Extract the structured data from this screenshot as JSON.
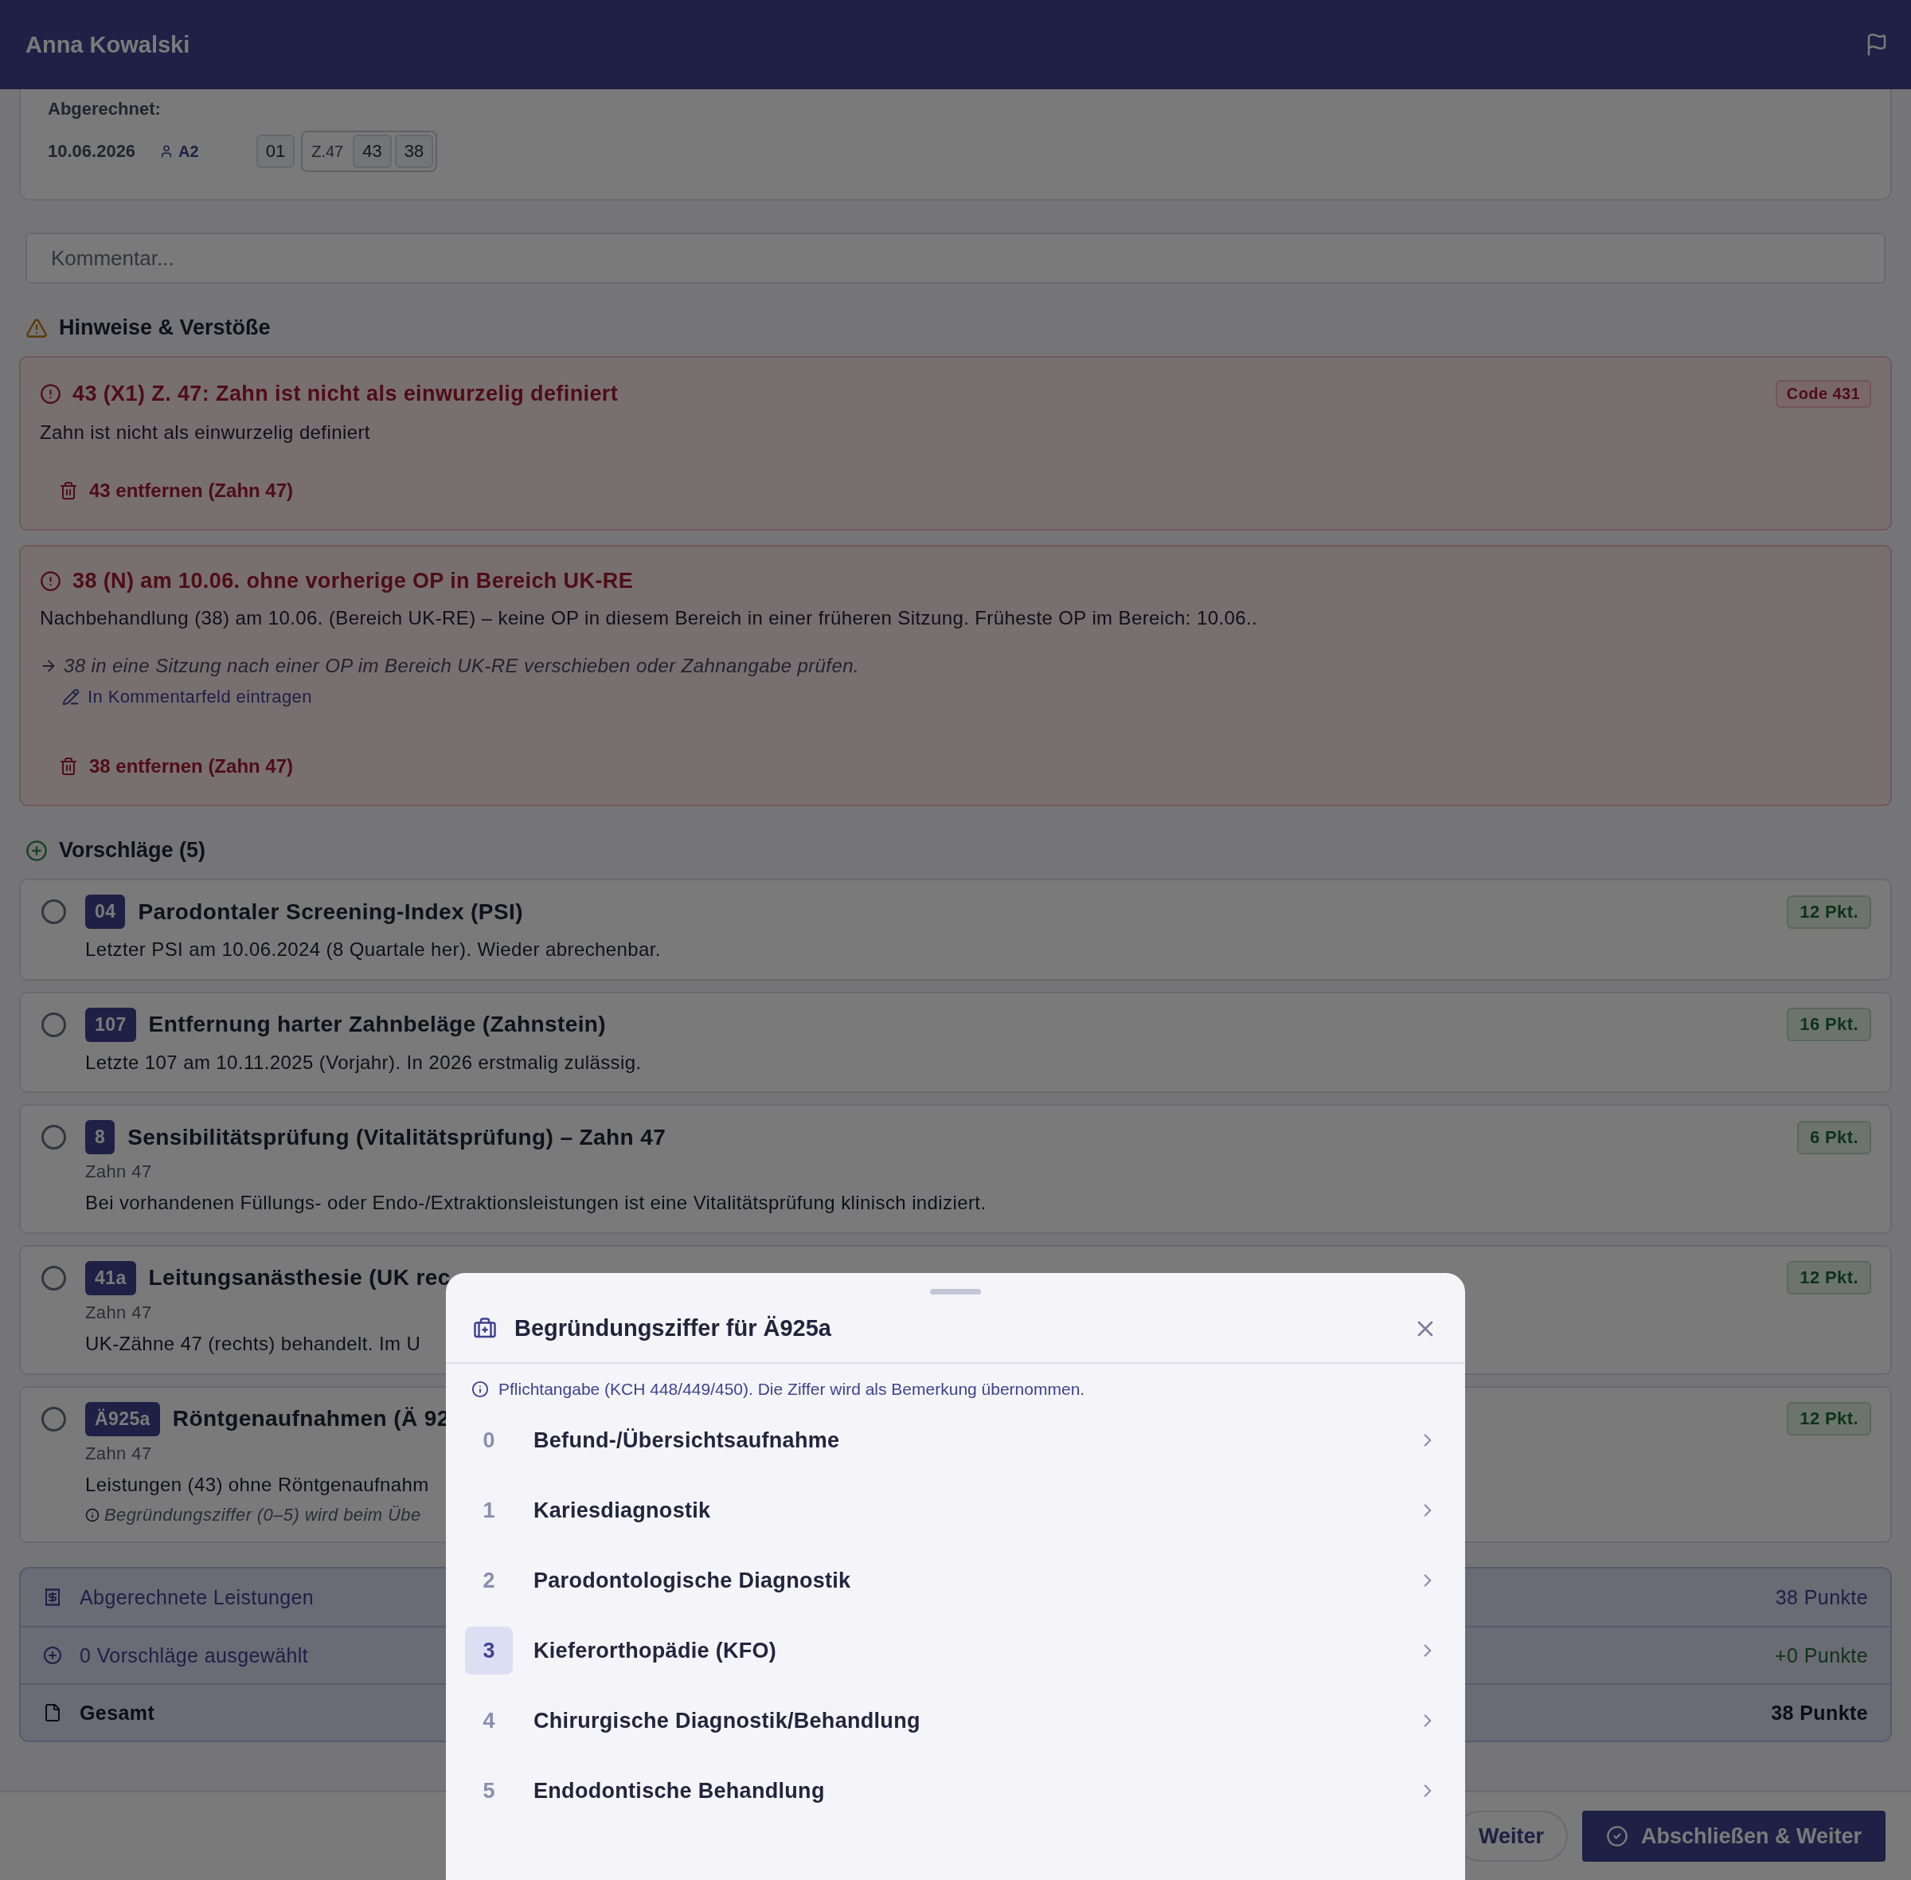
{
  "header": {
    "name": "Anna Kowalski"
  },
  "billed": {
    "label": "Abgerechnet:",
    "date": "10.06.2026",
    "user": "A2",
    "chips": [
      "01"
    ],
    "tooth_group": {
      "tooth": "Z.47",
      "codes": [
        "43",
        "38"
      ]
    }
  },
  "comment": {
    "placeholder": "Kommentar..."
  },
  "notices": {
    "title": "Hinweise & Verstöße",
    "items": [
      {
        "title": "43 (X1) Z. 47: Zahn ist nicht als einwurzelig definiert",
        "code": "Code 431",
        "text": "Zahn ist nicht als einwurzelig definiert",
        "action": "43 entfernen (Zahn 47)"
      },
      {
        "title": "38 (N) am 10.06. ohne vorherige OP in Bereich UK-RE",
        "text": "Nachbehandlung (38) am 10.06. (Bereich UK-RE) – keine OP in diesem Bereich in einer früheren Sitzung. Früheste OP im Bereich: 10.06..",
        "hint": "38 in eine Sitzung nach einer OP im Bereich UK-RE verschieben oder Zahnangabe prüfen.",
        "link": "In Kommentarfeld eintragen",
        "action": "38 entfernen (Zahn 47)"
      }
    ]
  },
  "suggestions": {
    "title": "Vorschläge (5)",
    "items": [
      {
        "code": "04",
        "title": "Parodontaler Screening-Index (PSI)",
        "text": "Letzter PSI am 10.06.2024 (8 Quartale her). Wieder abrechenbar.",
        "points": "12 Pkt.",
        "selected": false
      },
      {
        "code": "107",
        "title": "Entfernung harter Zahnbeläge (Zahnstein)",
        "text": "Letzte 107 am 10.11.2025 (Vorjahr). In 2026 erstmalig zulässig.",
        "points": "16 Pkt.",
        "selected": false
      },
      {
        "code": "8",
        "title": "Sensibilitätsprüfung (Vitalitätsprüfung) – Zahn 47",
        "tooth": "Zahn 47",
        "text": "Bei vorhandenen Füllungs- oder Endo-/Extraktionsleistungen ist eine Vitalitätsprüfung klinisch indiziert.",
        "points": "6 Pkt.",
        "selected": false
      },
      {
        "code": "41a",
        "title": "Leitungsanästhesie (UK rec",
        "tooth": "Zahn 47",
        "text": "UK-Zähne 47 (rechts) behandelt. Im U",
        "points": "12 Pkt.",
        "selected": false
      },
      {
        "code": "Ä925a",
        "title": "Röntgenaufnahmen (Ä 92",
        "tooth": "Zahn 47",
        "text": "Leistungen (43) ohne Röntgenaufnahm",
        "note": "Begründungsziffer (0–5) wird beim Übe",
        "points": "12 Pkt.",
        "selected": false
      }
    ]
  },
  "summary": [
    {
      "kind": "billed",
      "label": "Abgerechnete Leistungen",
      "value": "38 Punkte"
    },
    {
      "kind": "suggested",
      "label": "0 Vorschläge ausgewählt",
      "value": "+0 Punkte"
    },
    {
      "kind": "total",
      "label": "Gesamt",
      "value": "38 Punkte"
    }
  ],
  "footer": {
    "buttons": [
      {
        "kind": "secondary",
        "label": "Weiter"
      },
      {
        "kind": "primary",
        "label": "Abschließen & Weiter"
      }
    ]
  },
  "modal": {
    "title": "Begründungsziffer für Ä925a",
    "info": "Pflichtangabe (KCH 448/449/450). Die Ziffer wird als Bemerkung übernommen.",
    "options": [
      {
        "number": "0",
        "label": "Befund-/Übersichtsaufnahme",
        "selected": false
      },
      {
        "number": "1",
        "label": "Kariesdiagnostik",
        "selected": false
      },
      {
        "number": "2",
        "label": "Parodontologische Diagnostik",
        "selected": false
      },
      {
        "number": "3",
        "label": "Kieferorthopädie (KFO)",
        "selected": true
      },
      {
        "number": "4",
        "label": "Chirurgische Diagnostik/Behandlung",
        "selected": false
      },
      {
        "number": "5",
        "label": "Endodontische Behandlung",
        "selected": false
      }
    ]
  }
}
